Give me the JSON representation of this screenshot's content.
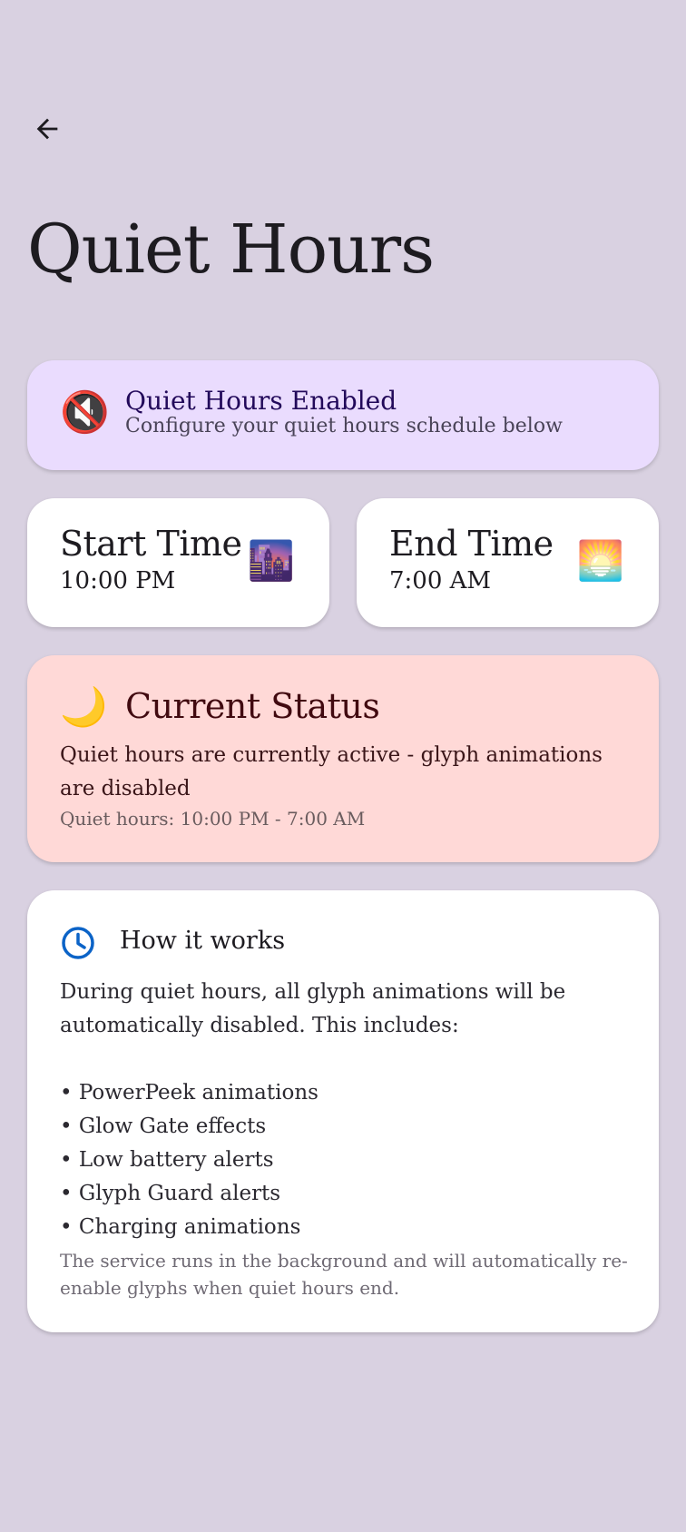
{
  "page": {
    "title": "Quiet Hours",
    "back_icon": "arrow-left-icon"
  },
  "banner": {
    "icon": "muted-speaker-icon",
    "emoji": "🔇",
    "title": "Quiet Hours Enabled",
    "subtitle": "Configure your quiet hours schedule below",
    "bg_color": "#eadcfe"
  },
  "start_time": {
    "label": "Start Time",
    "value": "10:00 PM",
    "icon": "night-city-icon",
    "emoji": "🌆"
  },
  "end_time": {
    "label": "End Time",
    "value": "7:00 AM",
    "icon": "sunrise-icon",
    "emoji": "🌅"
  },
  "status": {
    "icon": "crescent-moon-icon",
    "emoji": "🌙",
    "title": "Current Status",
    "message": "Quiet hours are currently active - glyph animations are disabled",
    "range": "Quiet hours: 10:00 PM - 7:00 AM",
    "bg_color": "#ffd9d7"
  },
  "how_it_works": {
    "icon": "clock-icon",
    "title": "How it works",
    "intro": "During quiet hours, all glyph animations will be automatically disabled. This includes:",
    "items": [
      "PowerPeek animations",
      "Glow Gate effects",
      "Low battery alerts",
      "Glyph Guard alerts",
      "Charging animations"
    ],
    "footer": "The service runs in the background and will automatically re-enable glyphs when quiet hours end.",
    "accent_color": "#0b63c7"
  }
}
